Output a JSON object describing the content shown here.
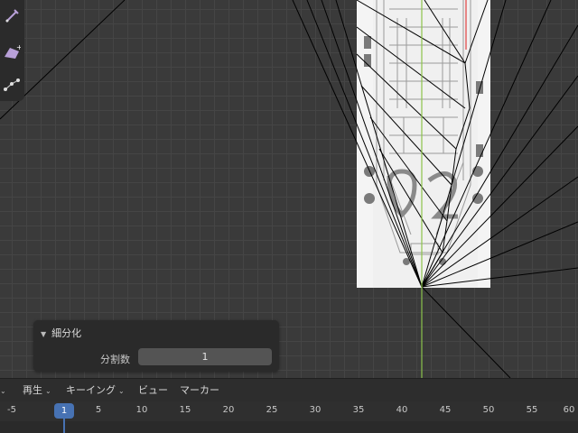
{
  "operator_panel": {
    "title": "細分化",
    "field_label": "分割数",
    "field_value": "1"
  },
  "timeline_header": {
    "menus": [
      {
        "label": "再生",
        "dropdown": true
      },
      {
        "label": "キーイング",
        "dropdown": true
      },
      {
        "label": "ビュー",
        "dropdown": false
      },
      {
        "label": "マーカー",
        "dropdown": false
      }
    ]
  },
  "timeline": {
    "ticks": [
      "-5",
      "5",
      "10",
      "15",
      "20",
      "25",
      "30",
      "35",
      "40",
      "45",
      "50",
      "55",
      "60"
    ],
    "current_frame": "1"
  },
  "colors": {
    "accent": "#4772b3",
    "y_axis": "#8bc34a",
    "x_axis": "#e04040",
    "tool_icon": "#b8a0d8"
  },
  "icons": [
    "pen-tool-icon",
    "extrude-icon",
    "vertex-path-icon",
    "chevron-down-icon",
    "triangle-expand-icon"
  ]
}
